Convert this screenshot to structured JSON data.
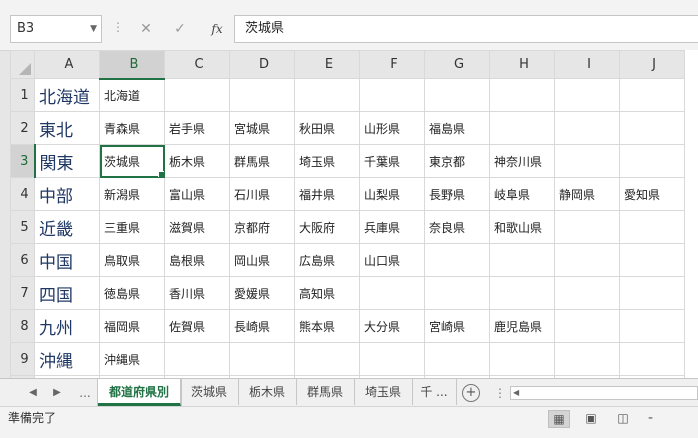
{
  "formula_bar": {
    "name_box": "B3",
    "cancel_icon": "cancel-icon",
    "enter_icon": "check-icon",
    "fx_label": "fx",
    "value": "茨城県"
  },
  "columns": [
    "A",
    "B",
    "C",
    "D",
    "E",
    "F",
    "G",
    "H",
    "I",
    "J"
  ],
  "selected_column": "B",
  "selected_row": "3",
  "rows": [
    {
      "num": "1",
      "region": "北海道",
      "cells": [
        "北海道",
        "",
        "",
        "",
        "",
        "",
        "",
        "",
        ""
      ]
    },
    {
      "num": "2",
      "region": "東北",
      "cells": [
        "青森県",
        "岩手県",
        "宮城県",
        "秋田県",
        "山形県",
        "福島県",
        "",
        "",
        ""
      ]
    },
    {
      "num": "3",
      "region": "関東",
      "cells": [
        "茨城県",
        "栃木県",
        "群馬県",
        "埼玉県",
        "千葉県",
        "東京都",
        "神奈川県",
        "",
        ""
      ]
    },
    {
      "num": "4",
      "region": "中部",
      "cells": [
        "新潟県",
        "富山県",
        "石川県",
        "福井県",
        "山梨県",
        "長野県",
        "岐阜県",
        "静岡県",
        "愛知県"
      ]
    },
    {
      "num": "5",
      "region": "近畿",
      "cells": [
        "三重県",
        "滋賀県",
        "京都府",
        "大阪府",
        "兵庫県",
        "奈良県",
        "和歌山県",
        "",
        ""
      ]
    },
    {
      "num": "6",
      "region": "中国",
      "cells": [
        "鳥取県",
        "島根県",
        "岡山県",
        "広島県",
        "山口県",
        "",
        "",
        "",
        ""
      ]
    },
    {
      "num": "7",
      "region": "四国",
      "cells": [
        "徳島県",
        "香川県",
        "愛媛県",
        "高知県",
        "",
        "",
        "",
        "",
        ""
      ]
    },
    {
      "num": "8",
      "region": "九州",
      "cells": [
        "福岡県",
        "佐賀県",
        "長崎県",
        "熊本県",
        "大分県",
        "宮崎県",
        "鹿児島県",
        "",
        ""
      ]
    },
    {
      "num": "9",
      "region": "沖縄",
      "cells": [
        "沖縄県",
        "",
        "",
        "",
        "",
        "",
        "",
        "",
        ""
      ]
    },
    {
      "num": "10",
      "region": "",
      "cells": [
        "",
        "",
        "",
        "",
        "",
        "",
        "",
        "",
        ""
      ]
    }
  ],
  "sheet_tabs": {
    "ellipsis_left": "...",
    "tabs": [
      "都道府県別",
      "茨城県",
      "栃木県",
      "群馬県",
      "埼玉県",
      "千 ..."
    ],
    "active_index": 0,
    "add_icon": "plus-icon",
    "more": "⋮"
  },
  "status_bar": {
    "status": "準備完了",
    "zoom_minus": "-"
  }
}
